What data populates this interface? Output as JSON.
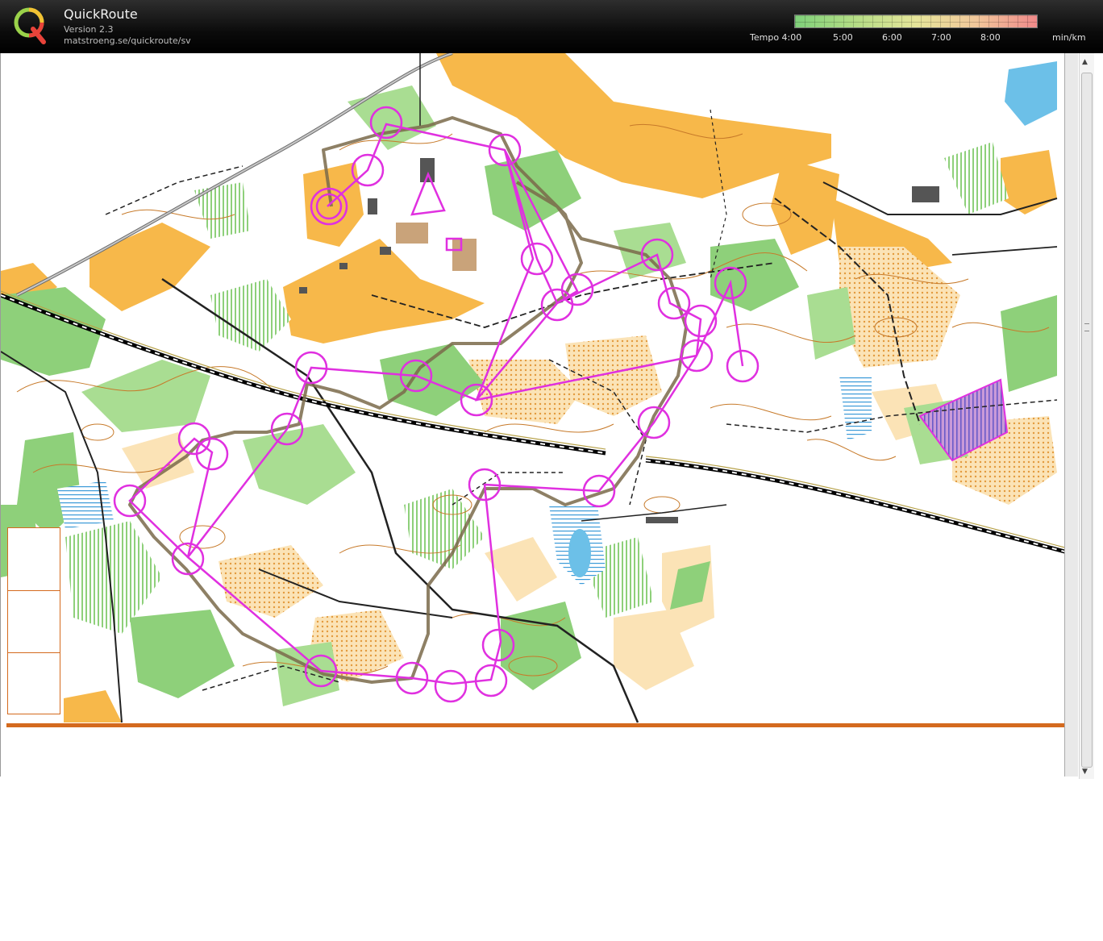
{
  "header": {
    "app_name": "QuickRoute",
    "version": "Version 2.3",
    "url": "matstroeng.se/quickroute/sv",
    "tempo": {
      "label": "Tempo 4:00",
      "ticks": [
        "5:00",
        "6:00",
        "7:00",
        "8:00"
      ],
      "unit": "min/km"
    }
  },
  "colors": {
    "course": "#e030e0",
    "route": "#7a6a4a",
    "open_land": "#f7b84a",
    "forest_green": "#8ed07a",
    "water": "#6cc0e8",
    "legend_border": "#d46a1e"
  },
  "icons": {
    "logo": "quickroute-q-logo",
    "scroll_up": "triangle-up-icon",
    "scroll_down": "triangle-down-icon"
  }
}
